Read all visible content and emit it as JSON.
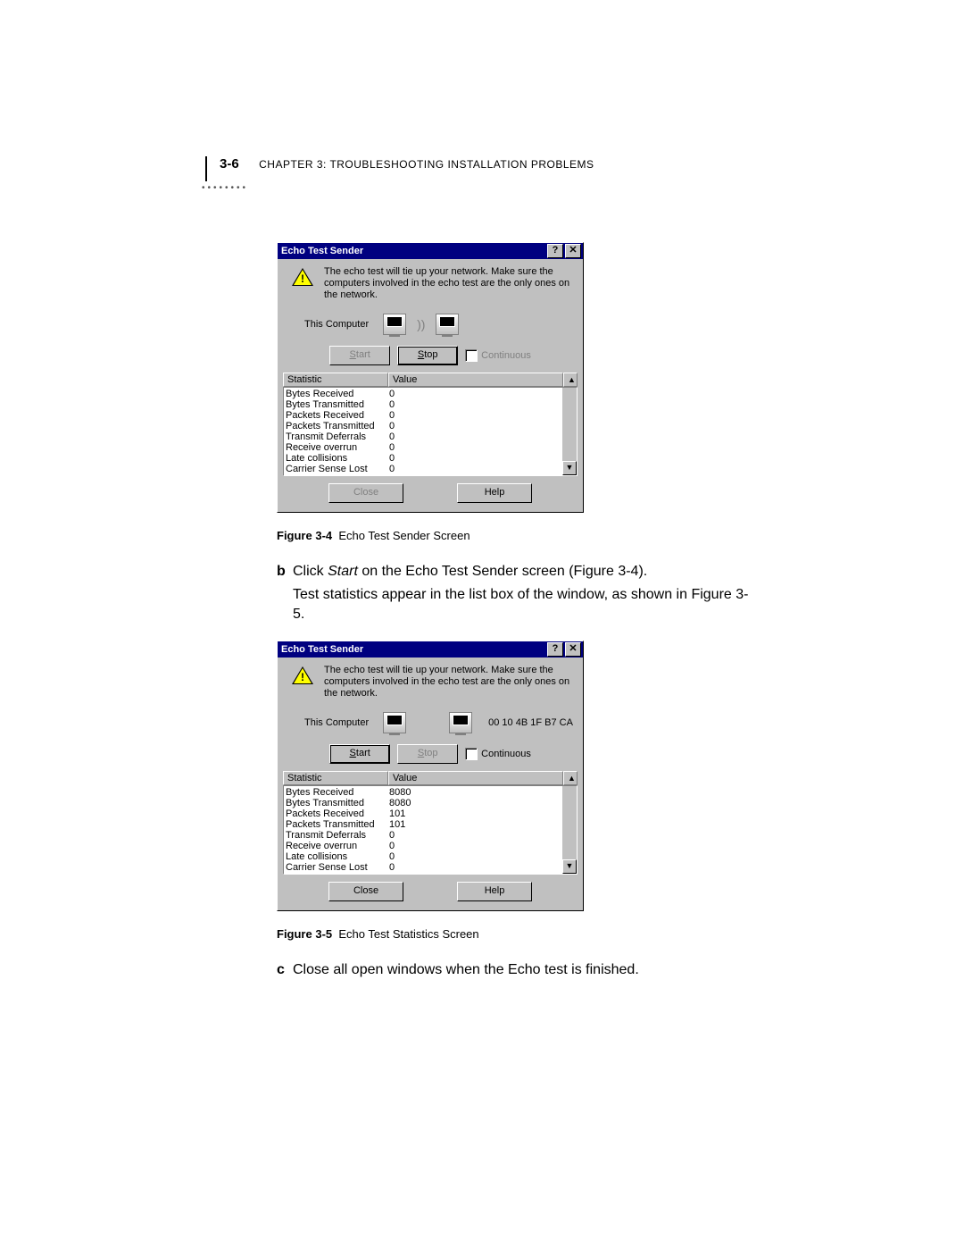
{
  "header": {
    "page_number": "3-6",
    "chapter_label": "CHAPTER 3: TROUBLESHOOTING INSTALLATION PROBLEMS"
  },
  "dialog1": {
    "title": "Echo Test Sender",
    "help_btn": "?",
    "close_btn": "✕",
    "warning": "The echo test will tie up your network. Make sure the computers involved in the echo test are the only ones on the network.",
    "this_computer": "This Computer",
    "mac": "",
    "start": "Start",
    "stop": "Stop",
    "continuous": "Continuous",
    "col_stat": "Statistic",
    "col_val": "Value",
    "scroll_up": "▲",
    "scroll_down": "▼",
    "close": "Close",
    "help": "Help",
    "rows": [
      {
        "name": "Bytes Received",
        "value": "0"
      },
      {
        "name": "Bytes Transmitted",
        "value": "0"
      },
      {
        "name": "Packets Received",
        "value": "0"
      },
      {
        "name": "Packets Transmitted",
        "value": "0"
      },
      {
        "name": "Transmit Deferrals",
        "value": "0"
      },
      {
        "name": "Receive overrun",
        "value": "0"
      },
      {
        "name": "Late collisions",
        "value": "0"
      },
      {
        "name": "Carrier Sense Lost",
        "value": "0"
      }
    ]
  },
  "caption1": {
    "label": "Figure 3-4",
    "text": "Echo Test Sender Screen"
  },
  "step_b": {
    "letter": "b",
    "line1_pre": "Click ",
    "line1_em": "Start",
    "line1_post": " on the Echo Test Sender screen (Figure 3-4).",
    "line2": "Test statistics appear in the list box of the window, as shown in Figure 3-5."
  },
  "dialog2": {
    "title": "Echo Test Sender",
    "help_btn": "?",
    "close_btn": "✕",
    "warning": "The echo test will tie up your network. Make sure the computers involved in the echo test are the only ones on the network.",
    "this_computer": "This Computer",
    "mac": "00 10 4B 1F B7 CA",
    "start": "Start",
    "stop": "Stop",
    "continuous": "Continuous",
    "col_stat": "Statistic",
    "col_val": "Value",
    "scroll_up": "▲",
    "scroll_down": "▼",
    "close": "Close",
    "help": "Help",
    "rows": [
      {
        "name": "Bytes Received",
        "value": "8080"
      },
      {
        "name": "Bytes Transmitted",
        "value": "8080"
      },
      {
        "name": "Packets Received",
        "value": "101"
      },
      {
        "name": "Packets Transmitted",
        "value": "101"
      },
      {
        "name": "Transmit Deferrals",
        "value": "0"
      },
      {
        "name": "Receive overrun",
        "value": "0"
      },
      {
        "name": "Late collisions",
        "value": "0"
      },
      {
        "name": "Carrier Sense Lost",
        "value": "0"
      }
    ]
  },
  "caption2": {
    "label": "Figure 3-5",
    "text": "Echo Test Statistics Screen"
  },
  "step_c": {
    "letter": "c",
    "text": "Close all open windows when the Echo test is finished."
  }
}
